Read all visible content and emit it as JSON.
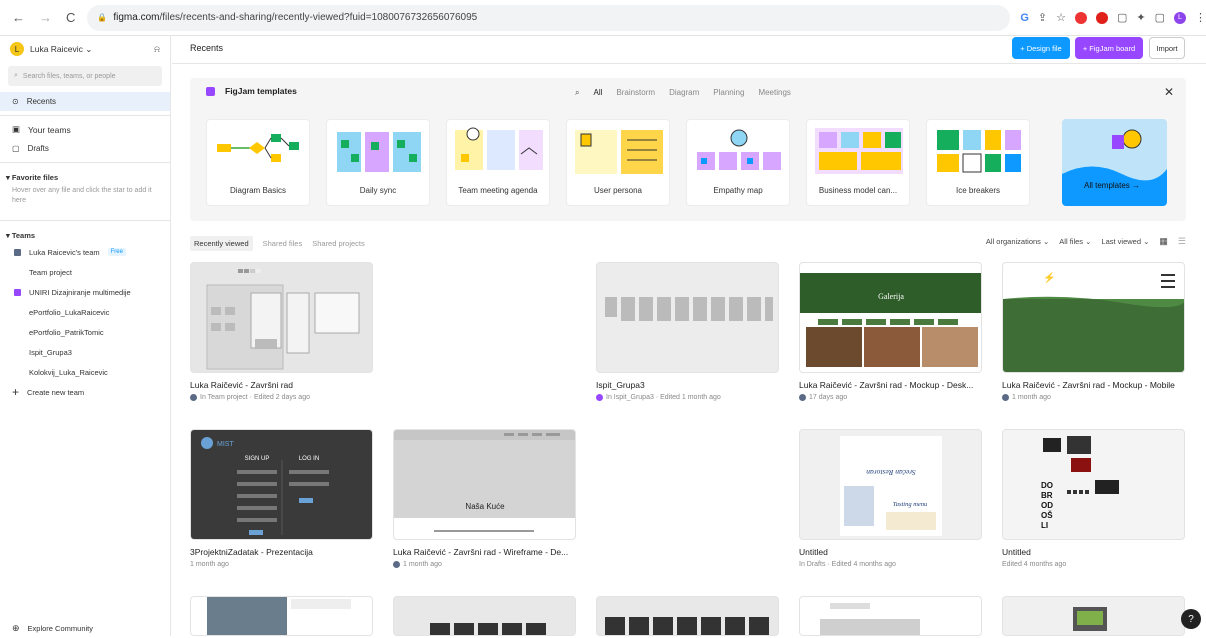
{
  "browser": {
    "back": "←",
    "forward": "→",
    "reload": "C",
    "host": "figma.com",
    "path": "/files/recents-and-sharing/recently-viewed?fuid=1080076732656076095",
    "lock": "🔒",
    "ext": [
      "G",
      "⇪",
      "☆",
      "●",
      "●",
      "▢",
      "✦",
      "▢",
      "L",
      "⋮"
    ]
  },
  "sidebar": {
    "account": "Luka Raicevic ⌄",
    "account_initial": "L",
    "bell": "🔔",
    "search_placeholder": "Search files, teams, or people",
    "nav": [
      {
        "icon": "⊙",
        "label": "Recents"
      },
      {
        "icon": "▣",
        "label": "Your teams"
      },
      {
        "icon": "▢",
        "label": "Drafts"
      }
    ],
    "favorites_title": "▾ Favorite files",
    "favorites_hint": "Hover over any file and click the star to add it here",
    "teams_title": "▾ Teams",
    "teams": [
      {
        "label": "Luka Raicevic's team",
        "badge": "Free",
        "color": "#5b6b86"
      },
      {
        "label": "Team project",
        "badge": "",
        "color": ""
      },
      {
        "label": "UNIRI Dizajniranje multimedije",
        "badge": "",
        "color": "#9747ff"
      },
      {
        "label": "ePortfolio_LukaRaicevic",
        "badge": "",
        "color": ""
      },
      {
        "label": "ePortfolio_PatrikTomic",
        "badge": "",
        "color": ""
      },
      {
        "label": "Ispit_Grupa3",
        "badge": "",
        "color": ""
      },
      {
        "label": "Kolokvij_Luka_Raicevic",
        "badge": "",
        "color": ""
      }
    ],
    "create_team": "Create new team",
    "explore": "Explore Community"
  },
  "header": {
    "title": "Recents",
    "design_file": "+ Design file",
    "figjam_board": "+ FigJam board",
    "import": "Import"
  },
  "templates": {
    "title": "FigJam templates",
    "categories": [
      "All",
      "Brainstorm",
      "Diagram",
      "Planning",
      "Meetings"
    ],
    "items": [
      "Diagram Basics",
      "Daily sync",
      "Team meeting agenda",
      "User persona",
      "Empathy map",
      "Business model can...",
      "Ice breakers"
    ],
    "all": "All templates →"
  },
  "tabs": [
    "Recently viewed",
    "Shared files",
    "Shared projects"
  ],
  "filters": [
    "All organizations ⌄",
    "All files ⌄",
    "Last viewed ⌄"
  ],
  "files": [
    {
      "title": "Luka Raičević - Završni rad",
      "meta": "In Team project · Edited 2 days ago",
      "dot": "#5b6b86"
    },
    {
      "title": "Ispit_Grupa3",
      "meta": "In Ispit_Grupa3 · Edited 1 month ago",
      "dot": "#9747ff"
    },
    {
      "title": "Luka Raičević - Završni rad - Mockup - Desk...",
      "meta": "17 days ago",
      "dot": "#5b6b86"
    },
    {
      "title": "Luka Raičević - Završni rad - Mockup - Mobile",
      "meta": "1 month ago",
      "dot": "#5b6b86"
    },
    {
      "title": "3ProjektniZadatak - Prezentacija",
      "meta": "1 month ago",
      "dot": ""
    },
    {
      "title": "Luka Raičević - Završni rad - Wireframe - De...",
      "meta": "1 month ago",
      "dot": "#5b6b86"
    },
    {
      "title": "Untitled",
      "meta": "In Drafts · Edited 4 months ago",
      "dot": ""
    },
    {
      "title": "Untitled",
      "meta": "Edited 4 months ago",
      "dot": ""
    }
  ],
  "thumb_text": {
    "galerija": "Galerija",
    "mist": "MIST",
    "signup": "SIGN UP",
    "login": "LOG IN",
    "nasa": "Naša Kuće",
    "dobro": "DO\nBR\nOD\nOŠ\nLI",
    "resto": "Srećan Restoran",
    "tasting": "Tasting menu"
  },
  "help": "?",
  "colors": {
    "blue": "#0d99ff",
    "purple": "#9747ff"
  }
}
